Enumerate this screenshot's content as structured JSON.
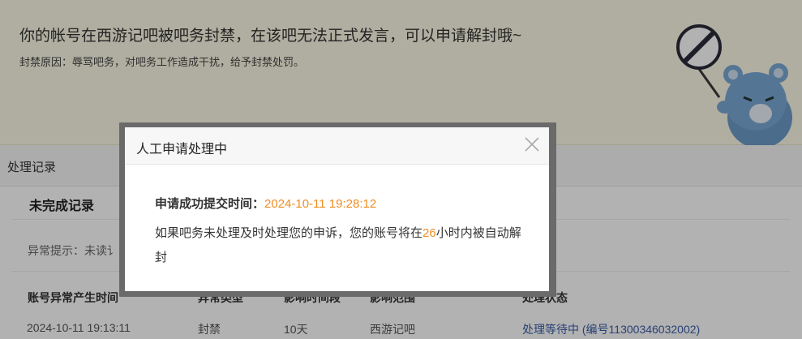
{
  "banner": {
    "title": "你的帐号在西游记吧被吧务封禁，在该吧无法正式发言，可以申请解封哦~",
    "reason": "封禁原因：辱骂吧务，对吧务工作造成干扰，给予封禁处罚。"
  },
  "records": {
    "section_title": "处理记录",
    "subhead": "未完成记录",
    "notice": "异常提示：未读讠"
  },
  "table": {
    "headers": [
      "账号异常产生时间",
      "异常类型",
      "影响时间段",
      "影响范围",
      "处理状态"
    ],
    "row": {
      "time": "2024-10-11 19:13:11",
      "type": "封禁",
      "duration": "10天",
      "scope": "西游记吧",
      "status": "处理等待中 (编号11300346032002)"
    }
  },
  "modal": {
    "title": "人工申请处理中",
    "submit_label": "申请成功提交时间：",
    "submit_time": "2024-10-11 19:28:12",
    "desc_before": "如果吧务未处理及时处理您的申诉，您的账号将在",
    "hours": "26",
    "desc_after": "小时内被自动解封",
    "close_icon": "close-icon"
  },
  "colors": {
    "accent_orange": "#f08d22",
    "link_blue": "#3b5ea8",
    "banner_bg": "#fdf9e5"
  }
}
